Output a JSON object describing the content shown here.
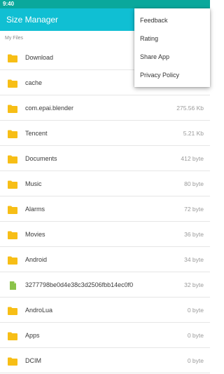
{
  "status_bar": {
    "time": "9:40"
  },
  "app_bar": {
    "title": "Size Manager"
  },
  "section_label": "My Files",
  "files": [
    {
      "name": "Download",
      "size": "",
      "type": "folder"
    },
    {
      "name": "cache",
      "size": "",
      "type": "folder"
    },
    {
      "name": "com.epai.blender",
      "size": "275.56 Kb",
      "type": "folder"
    },
    {
      "name": "Tencent",
      "size": "5.21 Kb",
      "type": "folder"
    },
    {
      "name": "Documents",
      "size": "412 byte",
      "type": "folder"
    },
    {
      "name": "Music",
      "size": "80 byte",
      "type": "folder"
    },
    {
      "name": "Alarms",
      "size": "72 byte",
      "type": "folder"
    },
    {
      "name": "Movies",
      "size": "36 byte",
      "type": "folder"
    },
    {
      "name": "Android",
      "size": "34 byte",
      "type": "folder"
    },
    {
      "name": "3277798be0d4e38c3d2506fbb14ec0f0",
      "size": "32 byte",
      "type": "file"
    },
    {
      "name": "AndroLua",
      "size": "0 byte",
      "type": "folder"
    },
    {
      "name": "Apps",
      "size": "0 byte",
      "type": "folder"
    },
    {
      "name": "DCIM",
      "size": "0 byte",
      "type": "folder"
    }
  ],
  "menu": {
    "items": [
      "Feedback",
      "Rating",
      "Share App",
      "Privacy Policy"
    ]
  },
  "colors": {
    "status_bar": "#0aa89c",
    "app_bar": "#10bfd3",
    "folder_icon": "#f7be16",
    "file_icon": "#8bc34a"
  },
  "icons": {
    "folder": "folder-icon",
    "file": "file-icon"
  }
}
